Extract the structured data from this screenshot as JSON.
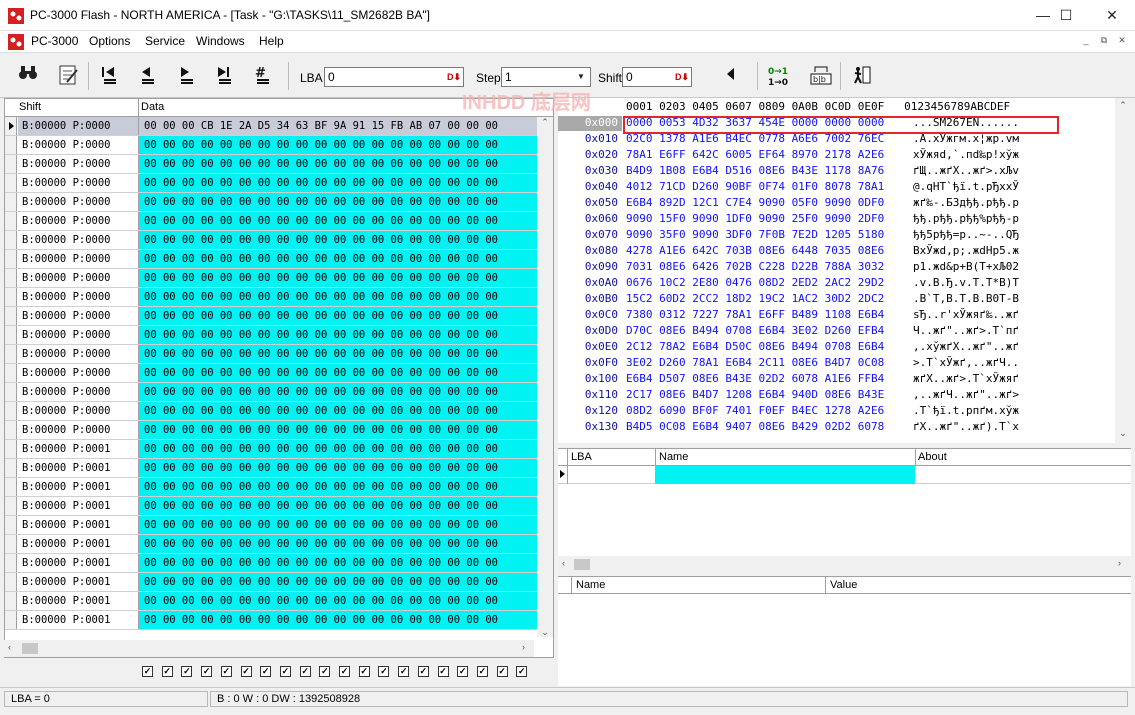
{
  "window": {
    "title": "PC-3000 Flash  - NORTH AMERICA - [Task - \"G:\\TASKS\\11_SM2682B BA\"]",
    "controls": [
      "—",
      "☐",
      "✕"
    ]
  },
  "menubar": {
    "items": [
      "PC-3000",
      "Options",
      "Service",
      "Windows",
      "Help"
    ],
    "mdi_controls": [
      "_",
      "⧉",
      "✕"
    ]
  },
  "toolbar": {
    "lba_label": "LBA",
    "lba_value": "0",
    "step_label": "Step",
    "step_value": "1",
    "shift_label": "Shift",
    "shift_value": "0"
  },
  "grid": {
    "headers": [
      "Shift",
      "Data"
    ],
    "rows": [
      {
        "shift": "B:00000 P:0000",
        "data": "00 00 00 CB 1E 2A D5 34 63 BF 9A 91 15 FB AB 07 00 00 00"
      },
      {
        "shift": "B:00000 P:0000",
        "data": "00 00 00 00 00 00 00 00 00 00 00 00 00 00 00 00 00 00 00"
      },
      {
        "shift": "B:00000 P:0000",
        "data": "00 00 00 00 00 00 00 00 00 00 00 00 00 00 00 00 00 00 00"
      },
      {
        "shift": "B:00000 P:0000",
        "data": "00 00 00 00 00 00 00 00 00 00 00 00 00 00 00 00 00 00 00"
      },
      {
        "shift": "B:00000 P:0000",
        "data": "00 00 00 00 00 00 00 00 00 00 00 00 00 00 00 00 00 00 00"
      },
      {
        "shift": "B:00000 P:0000",
        "data": "00 00 00 00 00 00 00 00 00 00 00 00 00 00 00 00 00 00 00"
      },
      {
        "shift": "B:00000 P:0000",
        "data": "00 00 00 00 00 00 00 00 00 00 00 00 00 00 00 00 00 00 00"
      },
      {
        "shift": "B:00000 P:0000",
        "data": "00 00 00 00 00 00 00 00 00 00 00 00 00 00 00 00 00 00 00"
      },
      {
        "shift": "B:00000 P:0000",
        "data": "00 00 00 00 00 00 00 00 00 00 00 00 00 00 00 00 00 00 00"
      },
      {
        "shift": "B:00000 P:0000",
        "data": "00 00 00 00 00 00 00 00 00 00 00 00 00 00 00 00 00 00 00"
      },
      {
        "shift": "B:00000 P:0000",
        "data": "00 00 00 00 00 00 00 00 00 00 00 00 00 00 00 00 00 00 00"
      },
      {
        "shift": "B:00000 P:0000",
        "data": "00 00 00 00 00 00 00 00 00 00 00 00 00 00 00 00 00 00 00"
      },
      {
        "shift": "B:00000 P:0000",
        "data": "00 00 00 00 00 00 00 00 00 00 00 00 00 00 00 00 00 00 00"
      },
      {
        "shift": "B:00000 P:0000",
        "data": "00 00 00 00 00 00 00 00 00 00 00 00 00 00 00 00 00 00 00"
      },
      {
        "shift": "B:00000 P:0000",
        "data": "00 00 00 00 00 00 00 00 00 00 00 00 00 00 00 00 00 00 00"
      },
      {
        "shift": "B:00000 P:0000",
        "data": "00 00 00 00 00 00 00 00 00 00 00 00 00 00 00 00 00 00 00"
      },
      {
        "shift": "B:00000 P:0000",
        "data": "00 00 00 00 00 00 00 00 00 00 00 00 00 00 00 00 00 00 00"
      },
      {
        "shift": "B:00000 P:0001",
        "data": "00 00 00 00 00 00 00 00 00 00 00 00 00 00 00 00 00 00 00"
      },
      {
        "shift": "B:00000 P:0001",
        "data": "00 00 00 00 00 00 00 00 00 00 00 00 00 00 00 00 00 00 00"
      },
      {
        "shift": "B:00000 P:0001",
        "data": "00 00 00 00 00 00 00 00 00 00 00 00 00 00 00 00 00 00 00"
      },
      {
        "shift": "B:00000 P:0001",
        "data": "00 00 00 00 00 00 00 00 00 00 00 00 00 00 00 00 00 00 00"
      },
      {
        "shift": "B:00000 P:0001",
        "data": "00 00 00 00 00 00 00 00 00 00 00 00 00 00 00 00 00 00 00"
      },
      {
        "shift": "B:00000 P:0001",
        "data": "00 00 00 00 00 00 00 00 00 00 00 00 00 00 00 00 00 00 00"
      },
      {
        "shift": "B:00000 P:0001",
        "data": "00 00 00 00 00 00 00 00 00 00 00 00 00 00 00 00 00 00 00"
      },
      {
        "shift": "B:00000 P:0001",
        "data": "00 00 00 00 00 00 00 00 00 00 00 00 00 00 00 00 00 00 00"
      },
      {
        "shift": "B:00000 P:0001",
        "data": "00 00 00 00 00 00 00 00 00 00 00 00 00 00 00 00 00 00 00"
      },
      {
        "shift": "B:00000 P:0001",
        "data": "00 00 00 00 00 00 00 00 00 00 00 00 00 00 00 00 00 00 00"
      }
    ]
  },
  "hex": {
    "header": "0001 0203 0405 0607 0809 0A0B 0C0D 0E0F   0123456789ABCDEF",
    "rows": [
      {
        "offset": "0x000",
        "bytes": "0000 0053 4D32 3637 454E 0000 0000 0000",
        "ascii": "...SM267EN......"
      },
      {
        "offset": "0x010",
        "bytes": "02C0 1378 A1E6 B4EC 0778 A6E6 7002 76EC",
        "ascii": ".A.xЎжгм.x¦жp.vм"
      },
      {
        "offset": "0x020",
        "bytes": "78A1 E6FF 642C 6005 EF64 8970 2178 A2E6",
        "ascii": "xЎжяd,`.пd‰p!xўж"
      },
      {
        "offset": "0x030",
        "bytes": "B4D9 1B08 E6B4 D516 08E6 B43E 1178 8A76",
        "ascii": "ґЩ..жґХ..жґ>.xЉv"
      },
      {
        "offset": "0x040",
        "bytes": "4012 71CD D260 90BF 0F74 01F0 8078 78A1",
        "ascii": "@.qНТ`ђї.t.рЂxxЎ"
      },
      {
        "offset": "0x050",
        "bytes": "E6B4 892D 12C1 C7E4 9090 05F0 9090 0DF0",
        "ascii": "жґ‰-.БЗдђђ.рђђ.р"
      },
      {
        "offset": "0x060",
        "bytes": "9090 15F0 9090 1DF0 9090 25F0 9090 2DF0",
        "ascii": "ђђ.рђђ.рђђ%рђђ-р"
      },
      {
        "offset": "0x070",
        "bytes": "9090 35F0 9090 3DF0 7F0B 7E2D 1205 5180",
        "ascii": "ђђ5рђђ=р..~-..QЂ"
      },
      {
        "offset": "0x080",
        "bytes": "4278 A1E6 642C 703B 08E6 6448 7035 08E6",
        "ascii": "BxЎжd,p;.жdHp5.ж"
      },
      {
        "offset": "0x090",
        "bytes": "7031 08E6 6426 702B C228 D22B 788A 3032",
        "ascii": "p1.жd&p+В(Т+xЉ02"
      },
      {
        "offset": "0x0A0",
        "bytes": "0676 10C2 2E80 0476 08D2 2ED2 2AC2 29D2",
        "ascii": ".v.В.Ђ.v.Т.Т*В)Т"
      },
      {
        "offset": "0x0B0",
        "bytes": "15C2 60D2 2CC2 18D2 19C2 1AC2 30D2 2DC2",
        "ascii": ".В`Т,В.Т.В.В0Т-В"
      },
      {
        "offset": "0x0C0",
        "bytes": "7380 0312 7227 78A1 E6FF B489 1108 E6B4",
        "ascii": "sЂ..r'xЎжяґ‰..жґ"
      },
      {
        "offset": "0x0D0",
        "bytes": "D70C 08E6 B494 0708 E6B4 3E02 D260 EFB4",
        "ascii": "Ч..жґ\"..жґ>.Т`пґ"
      },
      {
        "offset": "0x0E0",
        "bytes": "2C12 78A2 E6B4 D50C 08E6 B494 0708 E6B4",
        "ascii": ",.xўжґХ..жґ\"..жґ"
      },
      {
        "offset": "0x0F0",
        "bytes": "3E02 D260 78A1 E6B4 2C11 08E6 B4D7 0C08",
        "ascii": ">.Т`xЎжґ,..жґЧ.."
      },
      {
        "offset": "0x100",
        "bytes": "E6B4 D507 08E6 B43E 02D2 6078 A1E6 FFB4",
        "ascii": "жґХ..жґ>.Т`xЎжяґ"
      },
      {
        "offset": "0x110",
        "bytes": "2C17 08E6 B4D7 1208 E6B4 940D 08E6 B43E",
        "ascii": ",..жґЧ..жґ\"..жґ>"
      },
      {
        "offset": "0x120",
        "bytes": "08D2 6090 BF0F 7401 F0EF B4EC 1278 A2E6",
        "ascii": ".Т`ђї.t.рпґм.xўж"
      },
      {
        "offset": "0x130",
        "bytes": "B4D5 0C08 E6B4 9407 08E6 B429 02D2 6078",
        "ascii": "ґХ..жґ\"..жґ).Т`x"
      }
    ]
  },
  "lba_table": {
    "headers": [
      "LBA",
      "Name",
      "About"
    ],
    "accent": "#00f2f2"
  },
  "name_value_table": {
    "headers": [
      "Name",
      "Value"
    ]
  },
  "status": {
    "lba": "LBA =   0",
    "bw": "B : 0 W : 0 DW : 1392508928"
  },
  "watermark": "INHDD 底层网",
  "colors": {
    "data_bg": "#00f2f2",
    "hex_blue": "#1010ff",
    "highlight": "#e0272b"
  }
}
